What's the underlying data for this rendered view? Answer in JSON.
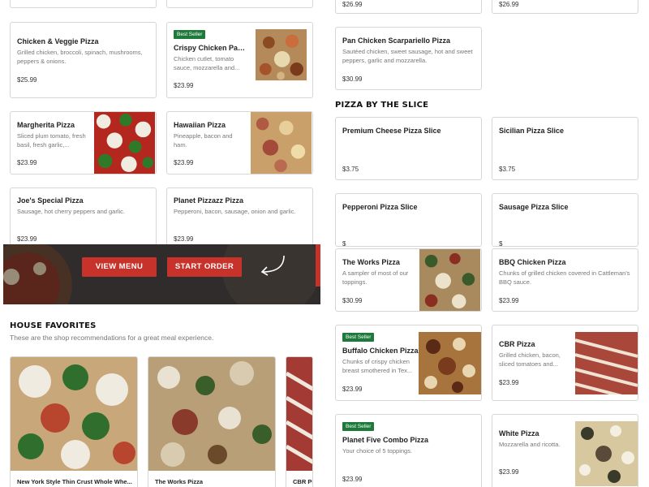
{
  "top_partial": {
    "price_left": "$26.99",
    "price_right": "$26.99"
  },
  "left_menu": [
    {
      "name": "Chicken & Veggie Pizza",
      "desc": "Grilled chicken, broccoli, spinach, mushrooms, peppers & onions.",
      "price": "$25.99"
    },
    {
      "name": "Crispy Chicken Parm...",
      "badge": "Best Seller",
      "desc": "Chicken cutlet, tomato sauce, mozzarella and...",
      "price": "$23.99"
    },
    {
      "name": "Margherita Pizza",
      "desc": "Sliced plum tomato, fresh basil, fresh garlic,...",
      "price": "$23.99"
    },
    {
      "name": "Hawaiian Pizza",
      "desc": "Pineapple, bacon and ham.",
      "price": "$23.99"
    },
    {
      "name": "Joe's Special Pizza",
      "desc": "Sausage, hot cherry peppers and garlic.",
      "price": "$23.99"
    },
    {
      "name": "Planet Pizzazz Pizza",
      "desc": "Pepperoni, bacon, sausage, onion and garlic.",
      "price": "$23.99"
    }
  ],
  "banner": {
    "view_menu": "VIEW MENU",
    "start_order": "START ORDER"
  },
  "house_favorites": {
    "title": "HOUSE FAVORITES",
    "subtitle": "These are the shop recommendations for a great meal experience.",
    "items": [
      {
        "name": "New York Style Thin Crust Whole Whe..."
      },
      {
        "name": "The Works Pizza"
      },
      {
        "name": "CBR Piz"
      }
    ]
  },
  "right_top": {
    "name": "Pan Chicken Scarpariello Pizza",
    "desc": "Sautéed chicken, sweet sausage, hot and sweet peppers, garlic and mozzarella.",
    "price": "$30.99"
  },
  "slice_section": {
    "title": "PIZZA BY THE SLICE",
    "items": [
      {
        "name": "Premium Cheese Pizza Slice",
        "price": "$3.75"
      },
      {
        "name": "Sicilian Pizza Slice",
        "price": "$3.75"
      },
      {
        "name": "Pepperoni Pizza Slice",
        "price": "$"
      },
      {
        "name": "Sausage Pizza Slice",
        "price": "$"
      }
    ]
  },
  "right_menu": [
    {
      "name": "The Works Pizza",
      "desc": "A sampler of most of our toppings.",
      "price": "$30.99"
    },
    {
      "name": "BBQ Chicken Pizza",
      "desc": "Chunks of grilled chicken covered in Cattleman's BBQ sauce.",
      "price": "$23.99"
    },
    {
      "name": "Buffalo Chicken Pizza",
      "badge": "Best Seller",
      "desc": "Chunks of crispy chicken breast smothered in Tex...",
      "price": "$23.99"
    },
    {
      "name": "CBR Pizza",
      "desc": "Grilled chicken, bacon, sliced tomatoes and...",
      "price": "$23.99"
    },
    {
      "name": "Planet Five Combo Pizza",
      "badge": "Best Seller",
      "desc": "Your choice of 5 toppings.",
      "price": "$23.99"
    },
    {
      "name": "White Pizza",
      "desc": "Mozzarella and ricotta.",
      "price": "$23.99"
    }
  ],
  "colors": {
    "accent_red": "#c7322b",
    "badge_green": "#1e7a3a",
    "border": "#d6d6d6"
  }
}
